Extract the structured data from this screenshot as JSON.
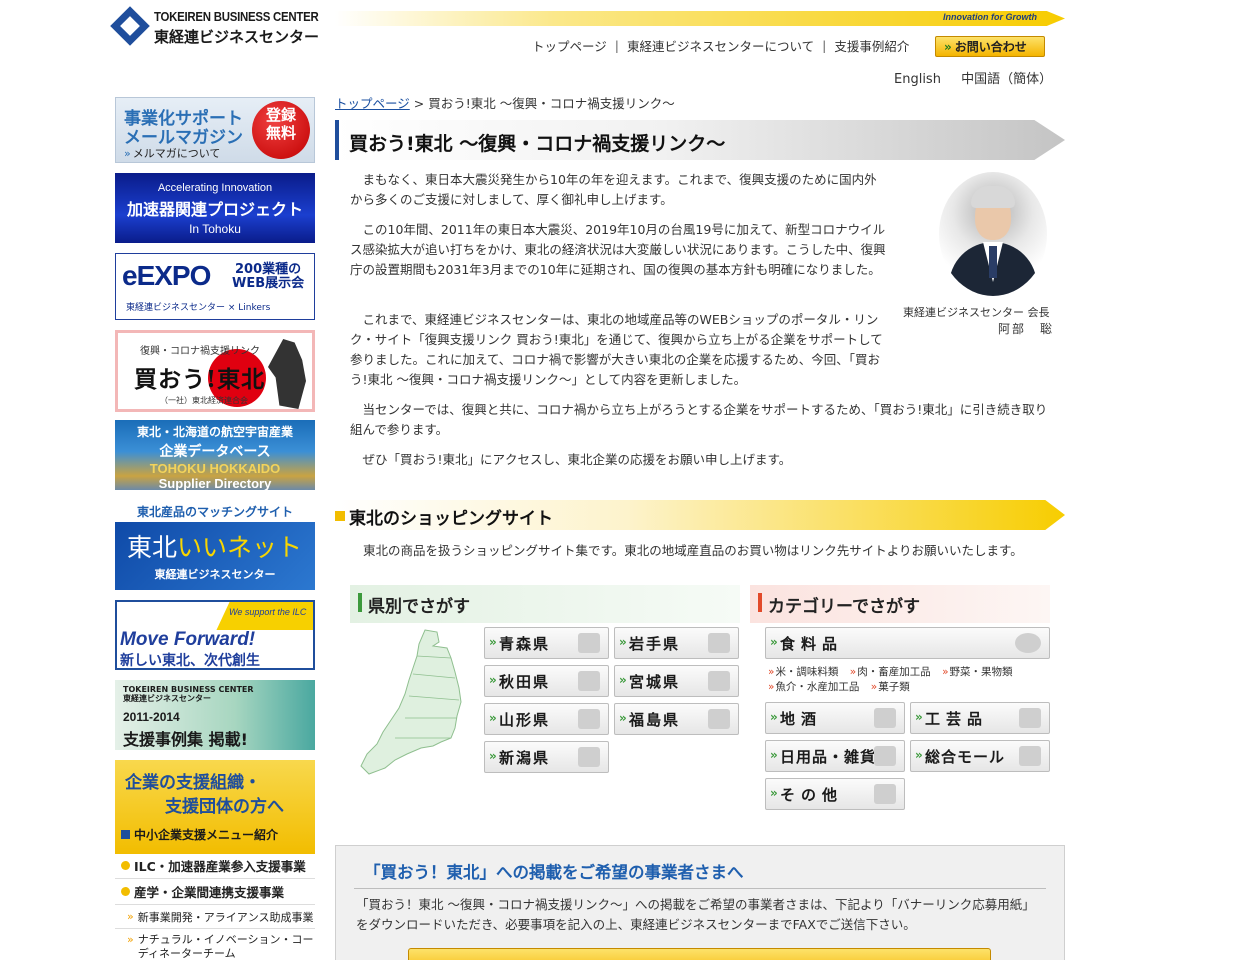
{
  "header": {
    "logo_en": "TOKEIREN BUSINESS CENTER",
    "logo_ja": "東経連ビジネスセンター",
    "tagline": "Innovation for Growth",
    "nav": [
      "トップページ",
      "東経連ビジネスセンターについて",
      "支援事例紹介"
    ],
    "contact": "お問い合わせ",
    "lang": [
      "English",
      "中国語（簡体）"
    ]
  },
  "sidebar": {
    "mailmag": {
      "line1": "事業化サポート",
      "line2": "メールマガジン",
      "link": "メルマガについて",
      "badge1": "登録",
      "badge2": "無料"
    },
    "accel": {
      "line1": "Accelerating Innovation",
      "line2": "加速器関連プロジェクト",
      "line3": "In Tohoku"
    },
    "expo": {
      "logo": "eEXPO",
      "line1": "200業種の",
      "line2": "WEB展示会",
      "footer": "東経連ビジネスセンター × Linkers"
    },
    "kaou": {
      "line1": "復興・コロナ禍支援リンク",
      "line2": "買おう!東北",
      "line3": "（一社）東北経済連合会"
    },
    "supplier": {
      "line1": "東北・北海道の航空宇宙産業",
      "line2": "企業データベース",
      "line3": "TOHOKU HOKKAIDO",
      "line4": "Supplier Directory"
    },
    "iinet": {
      "caption": "東北産品のマッチングサイト",
      "logo_a": "東北",
      "logo_b": "いいネット",
      "footer": "東経連ビジネスセンター"
    },
    "move": {
      "small": "We support the ILC",
      "line1": "Move Forward!",
      "line2": "新しい東北、次代創生"
    },
    "cases": {
      "small1": "TOKEIREN BUSINESS CENTER",
      "small2": "東経連ビジネスセンター",
      "line1": "2011-2014",
      "line2": "支援事例集 掲載!"
    },
    "org": {
      "line1": "企業の支援組織・",
      "line2": "支援団体の方へ",
      "line3": "中小企業支援メニュー紹介"
    },
    "links": [
      "ILC・加速器産業参入支援事業",
      "産学・企業間連携支援事業",
      "新事業開発・アライアンス助成事業",
      "ナチュラル・イノベーション・コーディネーターチーム"
    ]
  },
  "main": {
    "breadcrumb_home": "トップページ",
    "breadcrumb_current": "買おう!東北 〜復興・コロナ禍支援リンク〜",
    "title": "買おう!東北 〜復興・コロナ禍支援リンク〜",
    "paragraphs": [
      "　まもなく、東日本大震災発生から10年の年を迎えます。これまで、復興支援のために国内外から多くのご支援に対しまして、厚く御礼申し上げます。",
      "　この10年間、2011年の東日本大震災、2019年10月の台風19号に加えて、新型コロナウイルス感染拡大が追い打ちをかけ、東北の経済状況は大変厳しい状況にあります。こうした中、復興庁の設置期間も2031年3月までの10年に延期され、国の復興の基本方針も明確になりました。",
      "　これまで、東経連ビジネスセンターは、東北の地域産品等のWEBショップのポータル・リンク・サイト「復興支援リンク 買おう!東北」を通じて、復興から立ち上がる企業をサポートして参りました。これに加えて、コロナ禍で影響が大きい東北の企業を応援するため、今回、「買おう!東北 〜復興・コロナ禍支援リンク〜」として内容を更新しました。",
      "　当センターでは、復興と共に、コロナ禍から立ち上がろうとする企業をサポートするため、「買おう!東北」に引き続き取り組んで参ります。",
      "　ぜひ「買おう!東北」にアクセスし、東北企業の応援をお願い申し上げます。"
    ],
    "caption_title": "東経連ビジネスセンター 会長",
    "caption_name": "阿部　聡",
    "shop_title": "東北のショッピングサイト",
    "shop_desc": "東北の商品を扱うショッピングサイト集です。東北の地域産直品のお買い物はリンク先サイトよりお願いいたします。",
    "pref_head": "県別でさがす",
    "cat_head": "カテゴリーでさがす",
    "prefs": [
      "青森県",
      "岩手県",
      "秋田県",
      "宮城県",
      "山形県",
      "福島県",
      "新潟県"
    ],
    "food": "食料品",
    "food_subs": [
      "米・調味料類",
      "肉・畜産加工品",
      "野菜・果物類",
      "魚介・水産加工品",
      "菓子類"
    ],
    "cats": [
      "地酒",
      "工芸品",
      "日用品・雑貨",
      "総合モール",
      "その他"
    ],
    "apply_title": "「買おう！東北」への掲載をご希望の事業者さまへ",
    "apply_text": "「買おう！東北 〜復興・コロナ禍支援リンク〜」への掲載をご希望の事業者さまは、下記より「バナーリンク応募用紙」をダウンロードいただき、必要事項を記入の上、東経連ビジネスセンターまでFAXでご送信下さい。"
  }
}
